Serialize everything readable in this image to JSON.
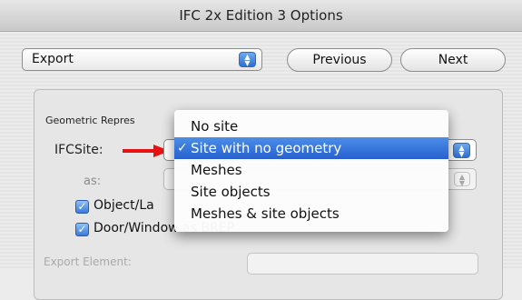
{
  "window": {
    "title": "IFC 2x Edition 3 Options"
  },
  "toolbar": {
    "export_popup_value": "Export",
    "previous_label": "Previous",
    "next_label": "Next"
  },
  "geometry_group": {
    "title": "Geometric Repres",
    "ifcsite_label": "IFCSite:",
    "as_label": "as:",
    "checkboxes": [
      {
        "label": "Object/La",
        "checked": true
      },
      {
        "label": "Door/Window as BREP",
        "checked": true
      }
    ]
  },
  "export_element": {
    "label": "Export Element:"
  },
  "ifcsite_menu": {
    "items": [
      {
        "label": "No site",
        "selected": false
      },
      {
        "label": "Site with no geometry",
        "selected": true
      },
      {
        "label": "Meshes",
        "selected": false
      },
      {
        "label": "Site objects",
        "selected": false
      },
      {
        "label": "Meshes & site objects",
        "selected": false
      }
    ],
    "check_mark": "✓"
  },
  "colors": {
    "accent_blue": "#2f6fd4",
    "selection_blue": "#2760cf",
    "arrow_red": "#e81010"
  },
  "icons": [
    "popup-arrows-icon",
    "red-arrow-icon",
    "checkmark-icon",
    "checkbox-checked-icon"
  ]
}
